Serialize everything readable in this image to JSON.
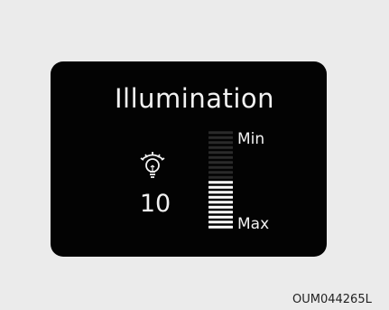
{
  "display": {
    "title": "Illumination",
    "icon": "dashboard-light-bulb-icon",
    "value": "10",
    "min_label": "Min",
    "max_label": "Max",
    "level": {
      "current": 10,
      "total_segments": 20
    }
  },
  "figure_code": "OUM044265L",
  "colors": {
    "background": "#ebebeb",
    "panel": "#030303",
    "active_segment": "#ffffff",
    "inactive_segment": "#2a2a2a",
    "text": "#f2f2f2"
  }
}
